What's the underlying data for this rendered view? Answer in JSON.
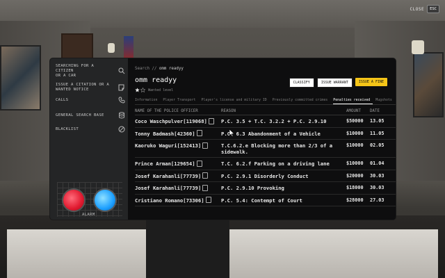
{
  "top_right": {
    "close_label": "CLOSE",
    "esc_label": "ESC"
  },
  "sidebar": {
    "items": [
      {
        "label": "SEARCHING FOR A\nCITIZEN\nOR A CAR",
        "icon": "search-icon"
      },
      {
        "label": "ISSUE A CITATION OR A\nWANTED NOTICE",
        "icon": "note-icon"
      },
      {
        "label": "CALLS",
        "icon": "phone-icon"
      },
      {
        "label": "GENERAL SEARCH BASE",
        "icon": "database-icon"
      },
      {
        "label": "BLACKLIST",
        "icon": "ban-icon"
      }
    ],
    "alarm_label": "ALARM"
  },
  "main": {
    "breadcrumb_root": "Search //",
    "breadcrumb_current": "omm readyy",
    "title": "omm readyy",
    "wanted_level": "Wanted level",
    "buttons": {
      "classify": "CLASSIFY",
      "warrant": "ISSUE WARRANT",
      "fine": "ISSUE A FINE"
    },
    "tabs": [
      {
        "label": "Information",
        "active": false
      },
      {
        "label": "Player Transport",
        "active": false
      },
      {
        "label": "Player's license and military ID",
        "active": false
      },
      {
        "label": "Previously committed crimes",
        "active": false
      },
      {
        "label": "Penalties received",
        "active": true
      },
      {
        "label": "Mugshots",
        "active": false
      }
    ],
    "table": {
      "headers": {
        "officer": "NAME OF THE POLICE OFFICER",
        "reason": "REASON",
        "amount": "AMOUNT",
        "date": "DATE"
      },
      "rows": [
        {
          "officer": "Coco Waschpulver[119068]",
          "reason": "P.C. 3.5 + T.C. 3.2.2 + P.C. 2.9.10",
          "amount": "$50000",
          "date": "13.05"
        },
        {
          "officer": "Tonny Badmash[42360]",
          "reason": "P.C. 6.3 Abandonment of a Vehicle",
          "amount": "$10000",
          "date": "11.05"
        },
        {
          "officer": "Kaoruko Waguri[152413]",
          "reason": "T.C.6.2.e Blocking more than 2/3 of a sidewalk.",
          "amount": "$10000",
          "date": "02.05"
        },
        {
          "officer": "Prince Arman[129654]",
          "reason": "T.C. 6.2.f Parking on a driving lane",
          "amount": "$10000",
          "date": "01.04"
        },
        {
          "officer": "Josef Karahanli[77739]",
          "reason": "P.C. 2.9.1 Disorderly Conduct",
          "amount": "$20000",
          "date": "30.03"
        },
        {
          "officer": "Josef Karahanli[77739]",
          "reason": "P.C. 2.9.10 Provoking",
          "amount": "$18000",
          "date": "30.03"
        },
        {
          "officer": "Cristiano Romano[73306]",
          "reason": "P.C. 5.4: Contempt of Court",
          "amount": "$28000",
          "date": "27.03"
        }
      ]
    }
  },
  "colors": {
    "accent_fine": "#f5c518",
    "alarm_red": "#e0192f",
    "alarm_blue": "#1c9fff"
  }
}
